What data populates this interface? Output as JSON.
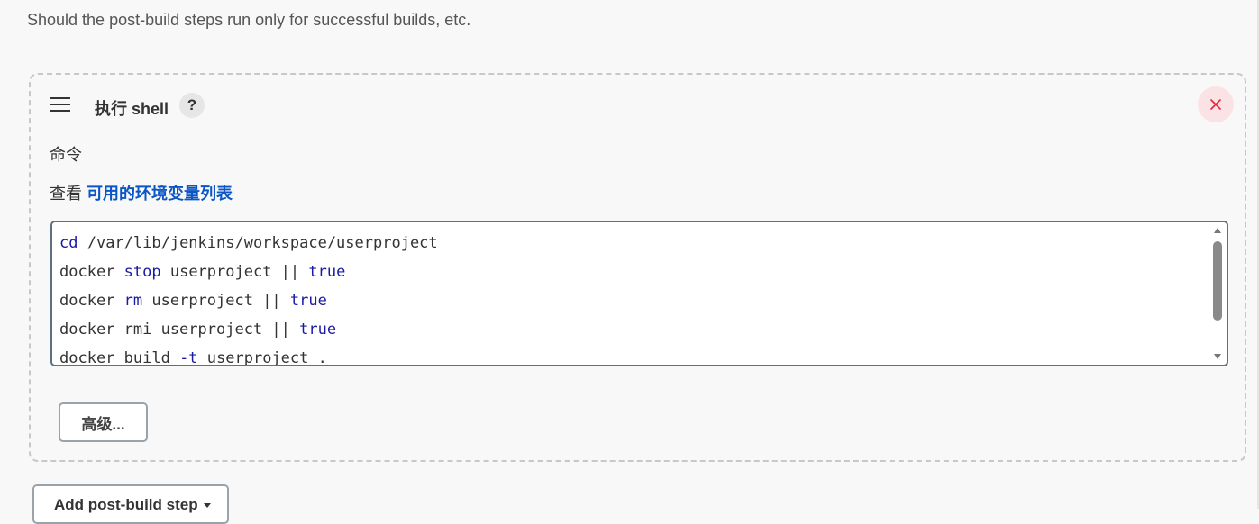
{
  "description": "Should the post-build steps run only for successful builds, etc.",
  "step": {
    "title": "执行 shell",
    "help_label": "?",
    "command_label": "命令",
    "env_prefix": "查看",
    "env_link": "可用的环境变量列表",
    "code_lines": [
      [
        {
          "t": "cd",
          "k": true
        },
        {
          "t": " /var/lib/jenkins/workspace/userproject",
          "k": false
        }
      ],
      [
        {
          "t": "docker ",
          "k": false
        },
        {
          "t": "stop",
          "k": true
        },
        {
          "t": " userproject || ",
          "k": false
        },
        {
          "t": "true",
          "k": true
        }
      ],
      [
        {
          "t": "docker ",
          "k": false
        },
        {
          "t": "rm",
          "k": true
        },
        {
          "t": " userproject || ",
          "k": false
        },
        {
          "t": "true",
          "k": true
        }
      ],
      [
        {
          "t": "docker rmi userproject || ",
          "k": false
        },
        {
          "t": "true",
          "k": true
        }
      ],
      [
        {
          "t": "docker build ",
          "k": false
        },
        {
          "t": "-t",
          "k": true
        },
        {
          "t": " userproject .",
          "k": false
        }
      ]
    ],
    "advanced_label": "高级..."
  },
  "add_step_label": "Add post-build step",
  "colors": {
    "accent_link": "#0b56c6",
    "close_red": "#e0263b",
    "keyword": "#1a1aa6"
  }
}
